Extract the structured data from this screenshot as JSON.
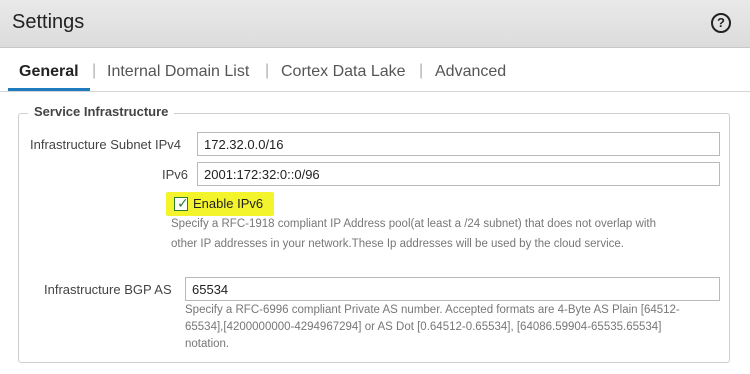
{
  "header": {
    "title": "Settings",
    "help_glyph": "?"
  },
  "tabs": [
    {
      "label": "General",
      "active": true
    },
    {
      "label": "Internal Domain List",
      "active": false
    },
    {
      "label": "Cortex Data Lake",
      "active": false
    },
    {
      "label": "Advanced",
      "active": false
    }
  ],
  "tab_separator": "|",
  "service_infrastructure": {
    "legend": "Service Infrastructure",
    "subnet_ipv4_label": "Infrastructure Subnet IPv4",
    "subnet_ipv4_value": "172.32.0.0/16",
    "ipv6_label": "IPv6",
    "ipv6_value": "2001:172:32:0::0/96",
    "enable_ipv6_label": "Enable IPv6",
    "enable_ipv6_checked": true,
    "enable_ipv6_highlight_color": "#f4f42c",
    "subnet_help_line1": "Specify a RFC-1918 compliant IP Address pool(at least a /24 subnet) that does not overlap with",
    "subnet_help_line2": "other IP addresses in your network.These Ip addresses will be used by the cloud service.",
    "bgp_as_label": "Infrastructure BGP AS",
    "bgp_as_value": "65534",
    "bgp_help_line1": "Specify a RFC-6996 compliant Private AS number. Accepted formats are 4-Byte AS Plain [64512-",
    "bgp_help_line2": "65534],[4200000000-4294967294] or AS Dot [0.64512-0.65534], [64086.59904-65535.65534]",
    "bgp_help_line3": "notation."
  },
  "colors": {
    "accent": "#1f7bbd",
    "check": "#2e7d32"
  }
}
